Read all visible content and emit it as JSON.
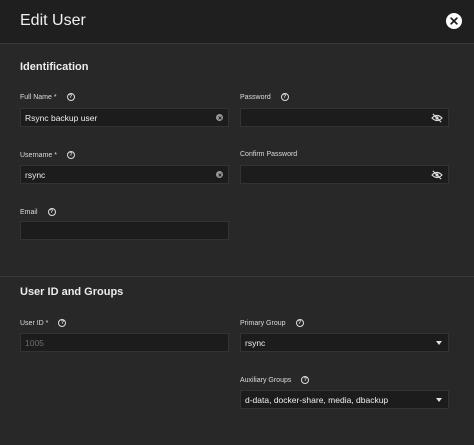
{
  "header": {
    "title": "Edit User"
  },
  "identification": {
    "section_title": "Identification",
    "full_name": {
      "label": "Full Name *",
      "value": "Rsync backup user"
    },
    "password": {
      "label": "Password",
      "value": ""
    },
    "username": {
      "label": "Username *",
      "value": "rsync"
    },
    "confirm_password": {
      "label": "Confirm Password",
      "value": ""
    },
    "email": {
      "label": "Email",
      "value": ""
    }
  },
  "ids_groups": {
    "section_title": "User ID and Groups",
    "user_id": {
      "label": "User ID *",
      "placeholder": "1005"
    },
    "primary_group": {
      "label": "Primary Group",
      "value": "rsync"
    },
    "auxiliary_groups": {
      "label": "Auxiliary Groups",
      "value": "d-data, docker-share, media, dbackup"
    }
  },
  "icons": {
    "help": "?",
    "close": "close-icon",
    "clear": "clear-icon",
    "visibility": "eye-off-icon",
    "dropdown": "caret-down-icon"
  }
}
